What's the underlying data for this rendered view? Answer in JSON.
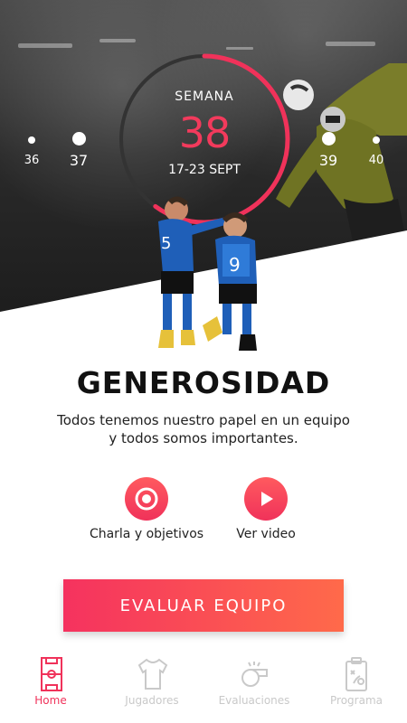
{
  "week_selector": {
    "current": {
      "label": "SEMANA",
      "number": "38",
      "range": "17-23 SEPT",
      "progress": 0.6
    },
    "others": [
      "36",
      "37",
      "39",
      "40"
    ]
  },
  "lesson": {
    "title": "GENEROSIDAD",
    "description": "Todos tenemos nuestro papel en un equipo y todos somos importantes."
  },
  "actions": [
    {
      "label": "Charla y objetivos",
      "icon": "target-icon"
    },
    {
      "label": "Ver video",
      "icon": "play-icon"
    }
  ],
  "cta": {
    "label": "EVALUAR EQUIPO"
  },
  "tabs": [
    {
      "label": "Home",
      "icon": "field-icon",
      "active": true
    },
    {
      "label": "Jugadores",
      "icon": "jersey-icon",
      "active": false
    },
    {
      "label": "Evaluaciones",
      "icon": "whistle-icon",
      "active": false
    },
    {
      "label": "Programa",
      "icon": "clipboard-icon",
      "active": false
    }
  ],
  "colors": {
    "accent": "#f0325a",
    "accent_gradient_end": "#ff6a4a",
    "inactive_tab": "#c9c9c9"
  }
}
